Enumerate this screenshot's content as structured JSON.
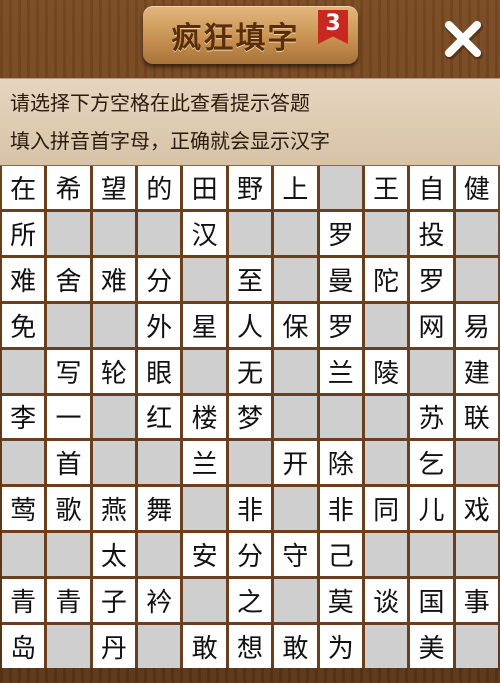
{
  "header": {
    "title": "疯狂填字",
    "level": "3",
    "close_icon": "close-x-icon"
  },
  "hints": {
    "line1": "请选择下方空格在此查看提示答题",
    "line2": "填入拼音首字母，正确就会显示汉字"
  },
  "colors": {
    "filled_cell": "#ffffff",
    "empty_cell": "#cfcfcf",
    "grid_border": "#6b3f1d",
    "level_badge": "#c8281f"
  },
  "grid": {
    "rows": 11,
    "cols": 11,
    "cells": [
      [
        "在",
        "希",
        "望",
        "的",
        "田",
        "野",
        "上",
        "",
        "王",
        "自",
        "健"
      ],
      [
        "所",
        "",
        "",
        "",
        "汉",
        "",
        "",
        "罗",
        "",
        "投",
        ""
      ],
      [
        "难",
        "舍",
        "难",
        "分",
        "",
        "至",
        "",
        "曼",
        "陀",
        "罗",
        ""
      ],
      [
        "免",
        "",
        "",
        "外",
        "星",
        "人",
        "保",
        "罗",
        "",
        "网",
        "易"
      ],
      [
        "",
        "写",
        "轮",
        "眼",
        "",
        "无",
        "",
        "兰",
        "陵",
        "",
        "建"
      ],
      [
        "李",
        "一",
        "",
        "红",
        "楼",
        "梦",
        "",
        "",
        "",
        "苏",
        "联"
      ],
      [
        "",
        "首",
        "",
        "",
        "兰",
        "",
        "开",
        "除",
        "",
        "乞",
        ""
      ],
      [
        "莺",
        "歌",
        "燕",
        "舞",
        "",
        "非",
        "",
        "非",
        "同",
        "儿",
        "戏"
      ],
      [
        "",
        "",
        "太",
        "",
        "安",
        "分",
        "守",
        "己",
        "",
        "",
        ""
      ],
      [
        "青",
        "青",
        "子",
        "衿",
        "",
        "之",
        "",
        "莫",
        "谈",
        "国",
        "事"
      ],
      [
        "岛",
        "",
        "丹",
        "",
        "敢",
        "想",
        "敢",
        "为",
        "",
        "美",
        ""
      ]
    ]
  }
}
